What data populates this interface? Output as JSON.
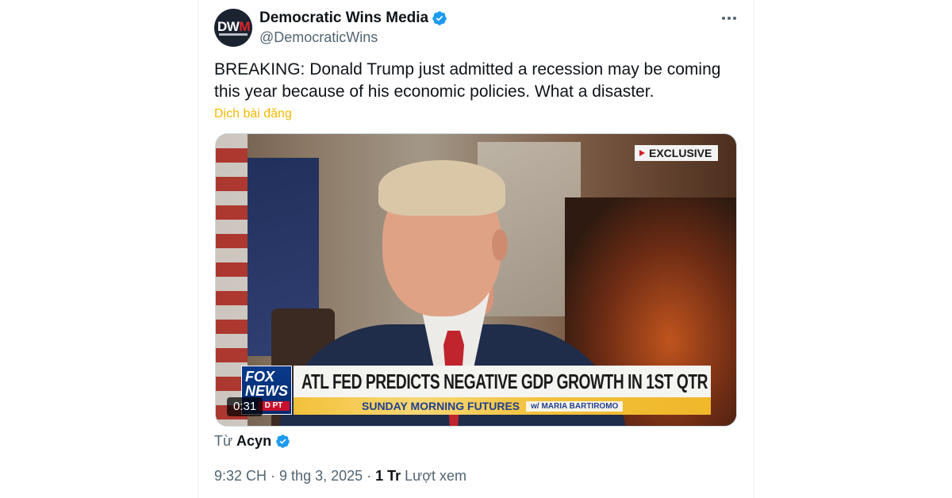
{
  "author": {
    "avatar_text": "DWM",
    "avatar_text_accent": "M",
    "display_name": "Democratic Wins Media",
    "handle": "@DemocraticWins",
    "verified_icon": "verified-badge-icon"
  },
  "tweet": {
    "text": "BREAKING: Donald Trump just admitted a recession may be coming this year because of his economic policies. What a disaster.",
    "translate_label": "Dịch bài đăng"
  },
  "media": {
    "badge": "EXCLUSIVE",
    "network": {
      "line1": "FOX",
      "line2": "NEWS",
      "line3": "D PT"
    },
    "headline": "ATL FED PREDICTS NEGATIVE GDP GROWTH IN 1ST QTR",
    "show": "SUNDAY MORNING FUTURES",
    "host": "w/ MARIA BARTIROMO",
    "duration": "0:31"
  },
  "source": {
    "prefix": "Từ",
    "author": "Acyn"
  },
  "meta": {
    "time": "9:32 CH",
    "separator": "·",
    "date": "9 thg 3, 2025",
    "separator2": "·",
    "views": "1 Tr",
    "views_label": "Lượt xem"
  },
  "colors": {
    "verified": "#1d9bf0",
    "translate": "#f5b900",
    "secondary_text": "#536471"
  }
}
